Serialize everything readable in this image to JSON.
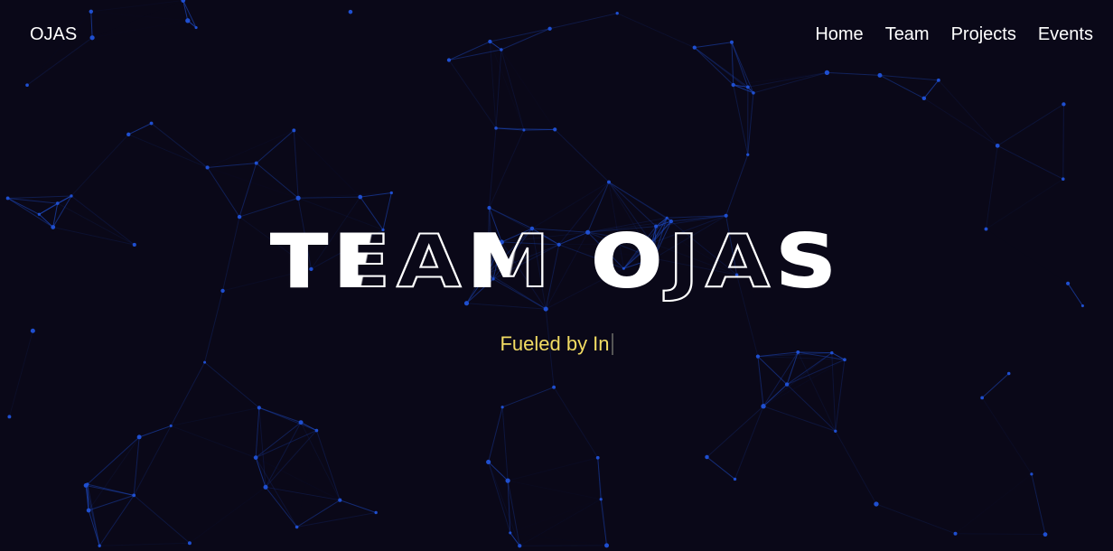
{
  "nav": {
    "brand": "OJAS",
    "links": [
      "Home",
      "Team",
      "Projects",
      "Events"
    ]
  },
  "hero": {
    "title_letters": [
      "T",
      "E",
      "A",
      "M",
      " ",
      "O",
      "J",
      "A",
      "S"
    ],
    "subtitle": "Fueled by In"
  },
  "colors": {
    "background": "#0a0818",
    "particle": "#1f4fd0",
    "subtitle": "#f2dc63"
  }
}
